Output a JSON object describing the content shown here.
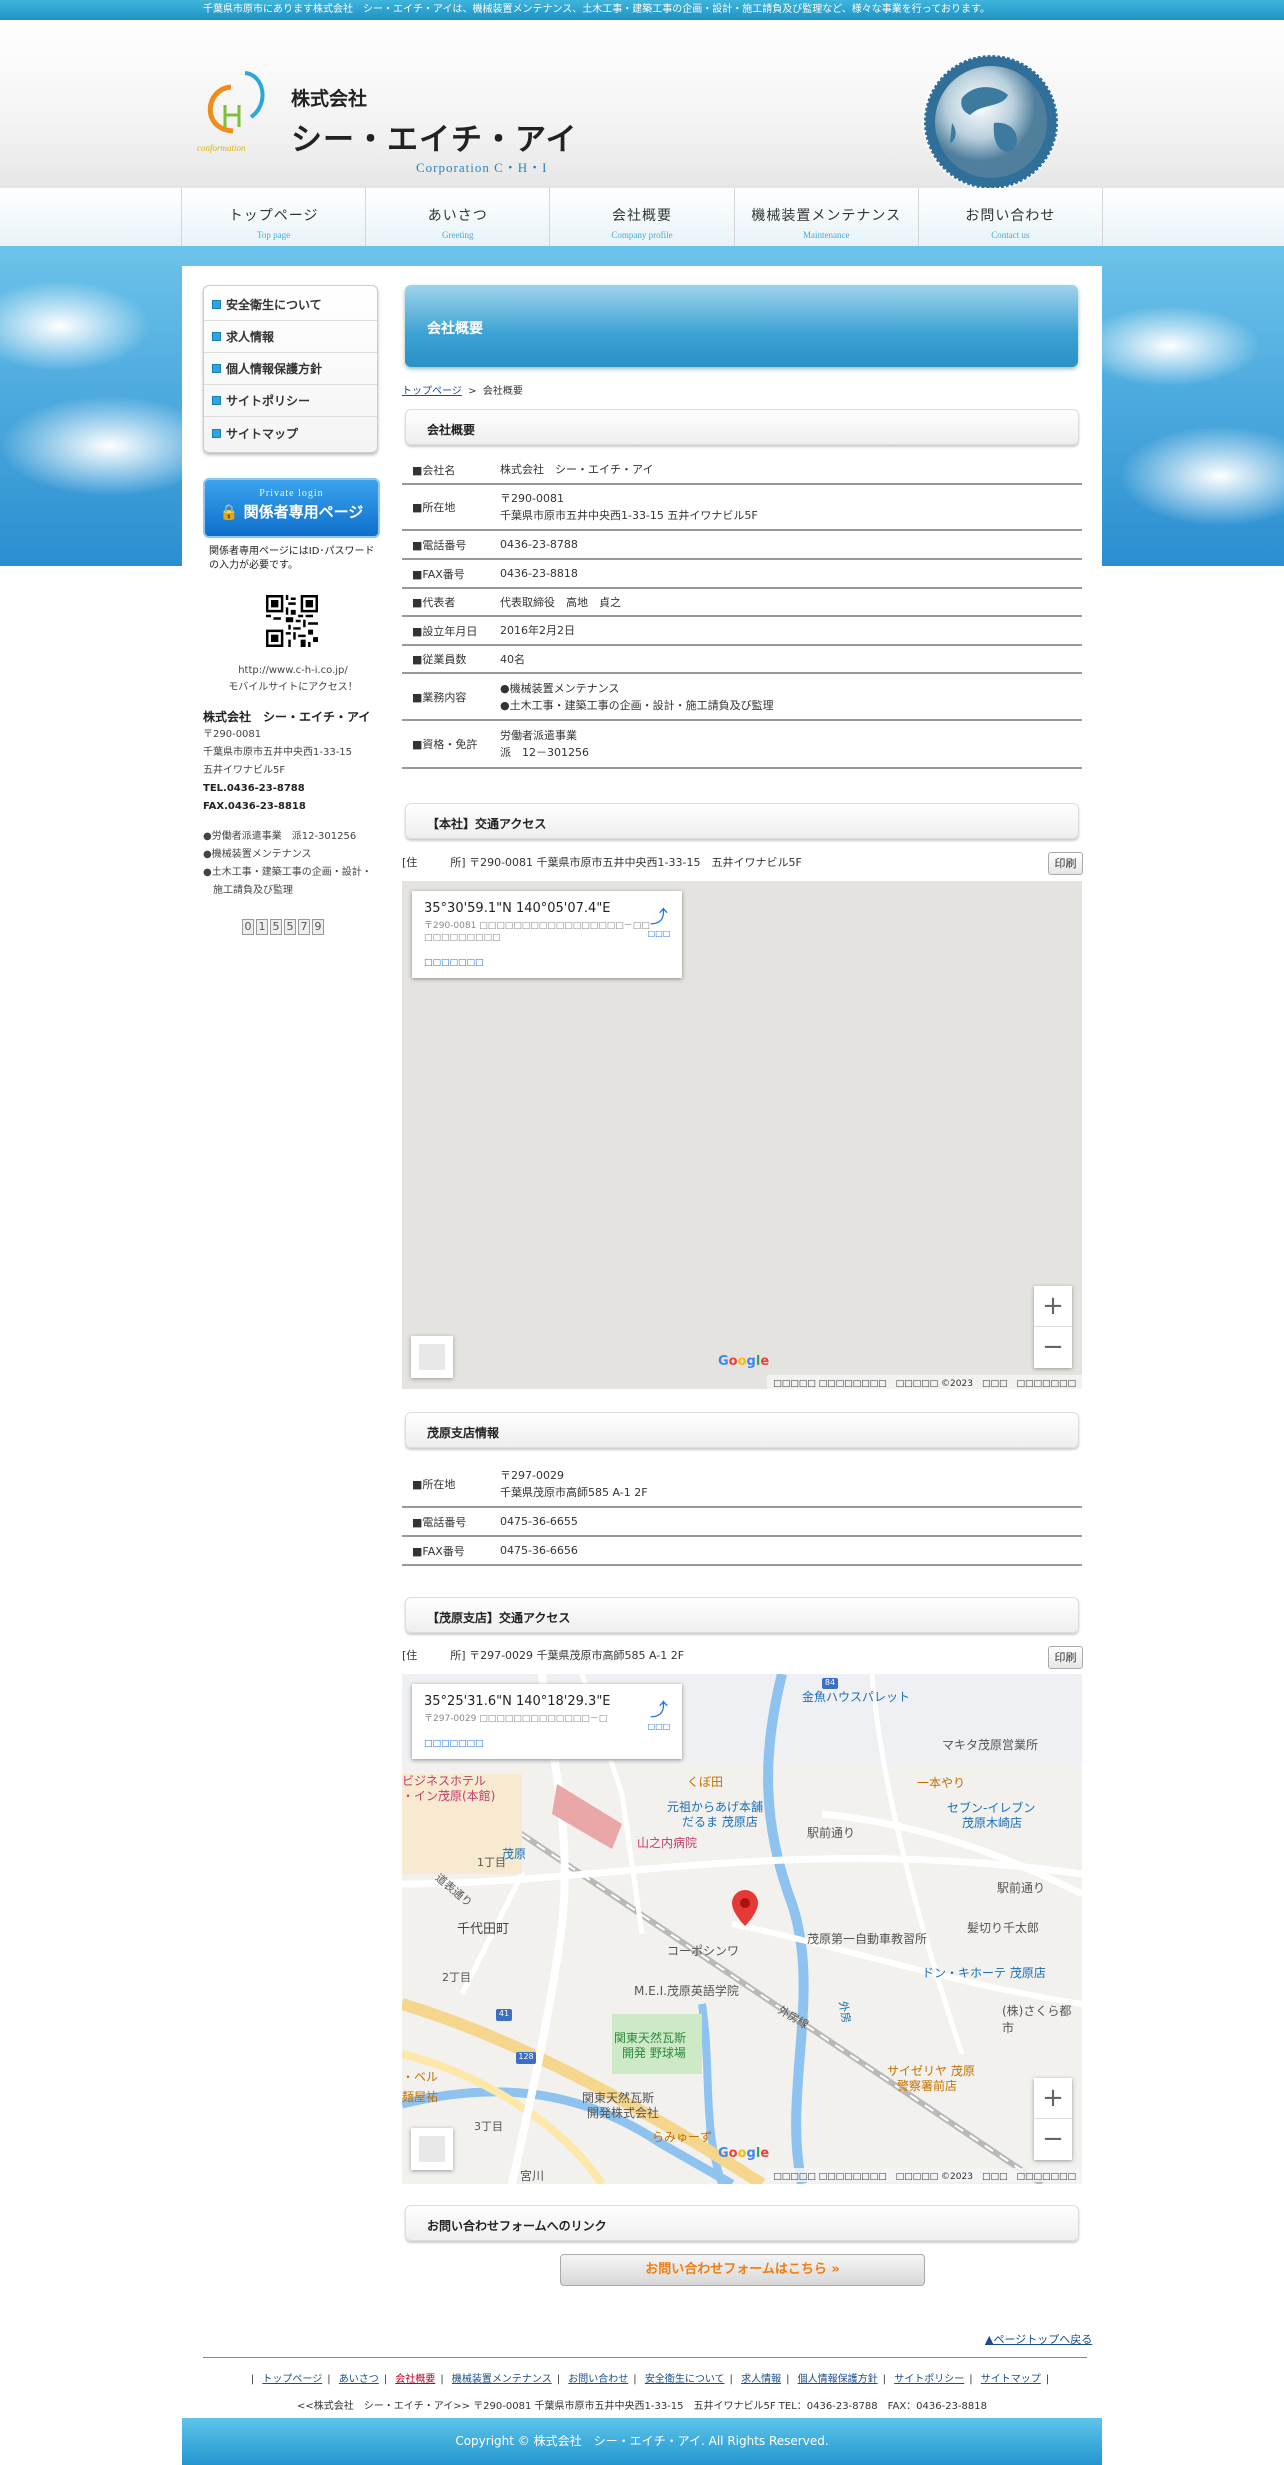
{
  "top_strip": "千葉県市原市にあります株式会社　シー・エイチ・アイは、機械装置メンテナンス、土木工事・建築工事の企画・設計・施工請負及び監理など、様々な事業を行っております。",
  "header": {
    "logo_text": "conformation",
    "company_small": "株式会社",
    "company_big": "シー・エイチ・アイ",
    "company_en": "Corporation C・H・I"
  },
  "nav": [
    {
      "jp": "トップページ",
      "en": "Top page"
    },
    {
      "jp": "あいさつ",
      "en": "Greeting"
    },
    {
      "jp": "会社概要",
      "en": "Company profile"
    },
    {
      "jp": "機械装置メンテナンス",
      "en": "Maintenance"
    },
    {
      "jp": "お問い合わせ",
      "en": "Contact us"
    }
  ],
  "sidebar": {
    "items": [
      {
        "label": "安全衛生について"
      },
      {
        "label": "求人情報"
      },
      {
        "label": "個人情報保護方針"
      },
      {
        "label": "サイトポリシー"
      },
      {
        "label": "サイトマップ"
      }
    ],
    "login_small": "Private login",
    "login_big": "関係者専用ページ",
    "login_note": "関係者専用ページにはID･パスワードの入力が必要です。",
    "url": "http://www.c-h-i.co.jp/",
    "mobile": "モバイルサイトにアクセス！",
    "company_name": "株式会社　シー・エイチ・アイ",
    "zip": "〒290-0081",
    "addr1": "千葉県市原市五井中央西1-33-15",
    "addr2": "五井イワナビル5F",
    "tel": "TEL.0436-23-8788",
    "fax": "FAX.0436-23-8818",
    "biz1": "●労働者派遣事業　派12-301256",
    "biz2": "●機械装置メンテナンス",
    "biz3": "●土木工事・建築工事の企画・設計・",
    "biz3b": "施工請負及び監理",
    "counter": [
      "0",
      "1",
      "5",
      "5",
      "7",
      "9"
    ]
  },
  "main": {
    "title": "会社概要",
    "breadcrumb_home": "トップページ",
    "breadcrumb_sep": ">",
    "breadcrumb_current": "会社概要",
    "section1": "会社概要",
    "profile": [
      {
        "k": "■会社名",
        "v1": "株式会社　シー・エイチ・アイ",
        "v2": ""
      },
      {
        "k": "■所在地",
        "v1": "〒290-0081",
        "v2": "千葉県市原市五井中央西1-33-15 五井イワナビル5F"
      },
      {
        "k": "■電話番号",
        "v1": "0436-23-8788",
        "v2": ""
      },
      {
        "k": "■FAX番号",
        "v1": "0436-23-8818",
        "v2": ""
      },
      {
        "k": "■代表者",
        "v1": "代表取締役　高地　貞之",
        "v2": ""
      },
      {
        "k": "■設立年月日",
        "v1": "2016年2月2日",
        "v2": ""
      },
      {
        "k": "■従業員数",
        "v1": "40名",
        "v2": ""
      },
      {
        "k": "■業務内容",
        "v1": "●機械装置メンテナンス",
        "v2": "●土木工事・建築工事の企画・設計・施工請負及び監理"
      },
      {
        "k": "■資格・免許",
        "v1": "労働者派遣事業",
        "v2": "派　12－301256"
      }
    ],
    "section2": "【本社】交通アクセス",
    "addr_line1": "[住　　　所] 〒290-0081 千葉県市原市五井中央西1-33-15　五井イワナビル5F",
    "print": "印刷",
    "map1": {
      "coord": "35°30'59.1\"N 140°05'07.4\"E",
      "addr": "〒290-0081 □□□□□□□□□□□□□□□□□－□□ □□□□□□□□□",
      "link": "□□□□□□□",
      "dir": "□□□",
      "attrib": "□□□□□ □□□□□□□□　□□□□□ ©2023　□□□　□□□□□□□"
    },
    "section3": "茂原支店情報",
    "branch": [
      {
        "k": "■所在地",
        "v1": "〒297-0029",
        "v2": "千葉県茂原市高師585 A-1 2F"
      },
      {
        "k": "■電話番号",
        "v1": "0475-36-6655",
        "v2": ""
      },
      {
        "k": "■FAX番号",
        "v1": "0475-36-6656",
        "v2": ""
      }
    ],
    "section4": "【茂原支店】交通アクセス",
    "addr_line2": "[住　　　所] 〒297-0029 千葉県茂原市高師585 A-1 2F",
    "map2": {
      "coord": "35°25'31.6\"N 140°18'29.3\"E",
      "addr": "〒297-0029 □□□□□□□□□□□□□－□",
      "link": "□□□□□□□",
      "dir": "□□□",
      "attrib": "□□□□□ □□□□□□□□　□□□□□ ©2023　□□□　□□□□□□□",
      "labels": {
        "l84": "84",
        "kingyo": "金魚ハウスパレット",
        "makita": "マキタ茂原営業所",
        "ichiman": "一本やり",
        "kubota": "くぼ田",
        "business": "ビジネスホテル",
        "inn": "・イン茂原(本館)",
        "genso": "元祖からあげ本舗",
        "daruma": "だるま 茂原店",
        "ekimae": "駅前通り",
        "seven": "セブン-イレブン",
        "seven2": "茂原木崎店",
        "yamanouchi": "山之内病院",
        "mobara": "茂原",
        "itchome": "1丁目",
        "ekimae2": "駅前通り",
        "hige": "髪切り千太郎",
        "chiyoda": "千代田町",
        "kosin": "コーポシンワ",
        "mobaradai1": "茂原第一自動車教習所",
        "donki": "ドン・キホーテ 茂原店",
        "nichome": "2丁目",
        "mei": "M.E.I.茂原英語学院",
        "sotobo": "外房線",
        "sakura": "(株)さくら都市",
        "l41": "41",
        "kanto1": "関東天然瓦斯",
        "kanto1b": "開発 野球場",
        "l128": "128",
        "saize": "サイゼリヤ 茂原",
        "keisatsu": "警察署前店",
        "bell": "・ベル",
        "menya": "麺屋祐",
        "kanto2": "関東天然瓦斯",
        "kanto2b": "開発株式会社",
        "sanchome": "3丁目",
        "ramen": "らみゅーず",
        "miyagawa": "宮川",
        "douro": "道表通り",
        "tochi": "外房"
      }
    },
    "section5": "お問い合わせフォームへのリンク",
    "form_link": "お問い合わせフォームはこちら »"
  },
  "footer": {
    "pagetop": "▲ページトップへ戻る",
    "links": [
      "トップページ",
      "あいさつ",
      "会社概要",
      "機械装置メンテナンス",
      "お問い合わせ",
      "安全衛生について",
      "求人情報",
      "個人情報保護方針",
      "サイトポリシー",
      "サイトマップ"
    ],
    "addr": "<<株式会社　シー・エイチ・アイ>> 〒290-0081 千葉県市原市五井中央西1-33-15　五井イワナビル5F TEL：0436-23-8788　FAX：0436-23-8818",
    "copyright": "Copyright © 株式会社　シー・エイチ・アイ. All Rights Reserved."
  },
  "colors": {
    "accent": "#2c91c6",
    "link": "#1a4d8c",
    "orange": "#f07d14"
  }
}
